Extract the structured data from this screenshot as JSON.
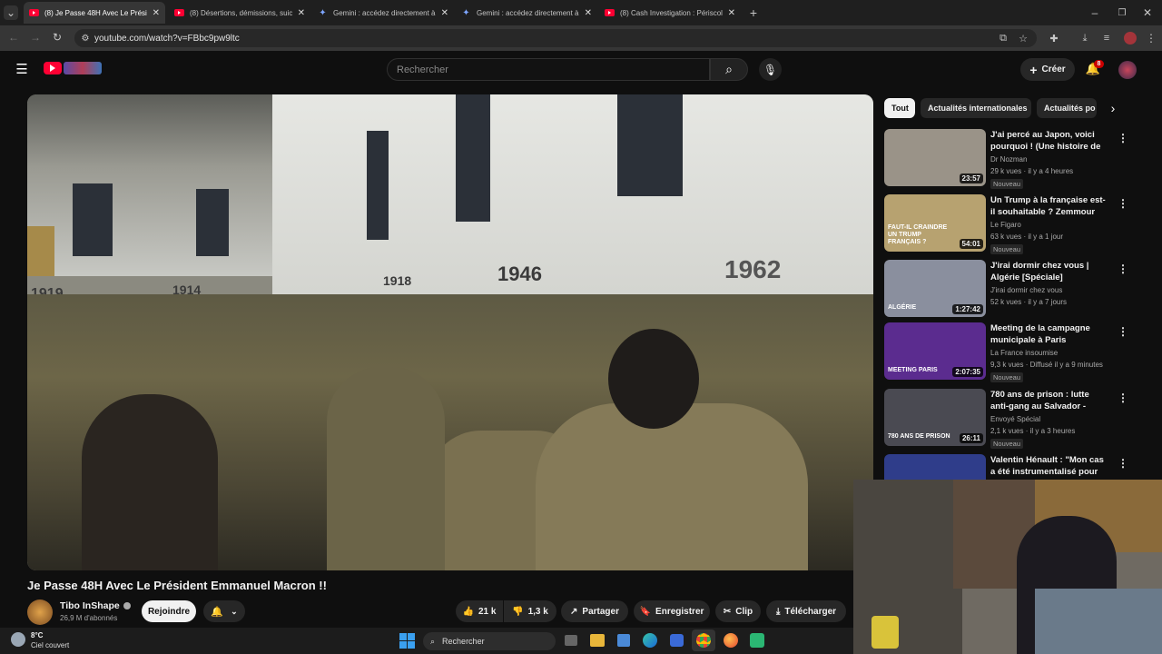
{
  "browser": {
    "tabs": [
      {
        "title": "(8) Je Passe 48H Avec Le Présid",
        "icon": "youtube",
        "active": true
      },
      {
        "title": "(8) Désertions, démissions, suic",
        "icon": "youtube",
        "active": false
      },
      {
        "title": "Gemini : accédez directement à",
        "icon": "gemini",
        "active": false
      },
      {
        "title": "Gemini : accédez directement à",
        "icon": "gemini",
        "active": false
      },
      {
        "title": "(8) Cash Investigation : Périscol",
        "icon": "youtube",
        "active": false
      }
    ],
    "url": "youtube.com/watch?v=FBbc9pw9ltc"
  },
  "header": {
    "search_placeholder": "Rechercher",
    "create_label": "Créer",
    "notif_count": "8"
  },
  "video": {
    "title": "Je Passe 48H Avec Le Président Emmanuel Macron !!",
    "channel": "Tibo InShape",
    "subscribers": "26,9 M d'abonnés",
    "join_label": "Rejoindre",
    "likes": "21 k",
    "dislikes": "1,3 k",
    "share_label": "Partager",
    "save_label": "Enregistrer",
    "clip_label": "Clip",
    "download_label": "Télécharger",
    "wall_texts": [
      "1919",
      "1914",
      "1918",
      "1946",
      "1962"
    ]
  },
  "chips": [
    "Tout",
    "Actualités internationales",
    "Actualités po"
  ],
  "recommendations": [
    {
      "title": "J'ai percé au Japon, voici pourquoi ! (Une histoire de ...",
      "channel": "Dr Nozman",
      "meta": "29 k vues · il y a 4 heures",
      "duration": "23:57",
      "badge": "Nouveau",
      "thumb_color": "#9a9388"
    },
    {
      "title": "Un Trump à la française est-il souhaitable ? Zemmour face à...",
      "channel": "Le Figaro",
      "meta": "63 k vues · il y a 1 jour",
      "duration": "54:01",
      "badge": "Nouveau",
      "thumb_text": "FAUT-IL CRAINDRE UN TRUMP FRANÇAIS ?",
      "thumb_color": "#b7a270"
    },
    {
      "title": "J'irai dormir chez vous | Algérie [Spéciale]",
      "channel": "J'irai dormir chez vous",
      "meta": "52 k vues · il y a 7 jours",
      "duration": "1:27:42",
      "badge": "",
      "thumb_text": "ALGÉRIE",
      "thumb_color": "#8a8f9e"
    },
    {
      "title": "Meeting de la campagne municipale à Paris",
      "channel": "La France insoumise",
      "meta": "9,3 k vues · Diffusé il y a 9 minutes",
      "duration": "2:07:35",
      "badge": "Nouveau",
      "thumb_text": "MEETING PARIS",
      "thumb_color": "#5b2c8f"
    },
    {
      "title": "780 ans de prison : lutte anti-gang au Salvador - reportage ...",
      "channel": "Envoyé Spécial",
      "meta": "2,1 k vues · il y a 3 heures",
      "duration": "26:11",
      "badge": "Nouveau",
      "thumb_text": "780 ANS DE PRISON",
      "thumb_color": "#4a4a52"
    },
    {
      "title": "Valentin Hénault : \"Mon cas a été instrumentalisé pour jeter l...",
      "channel": "",
      "meta": "",
      "duration": "",
      "badge": "",
      "thumb_color": "#2f3d8a"
    }
  ],
  "taskbar": {
    "temp": "8°C",
    "weather": "Ciel couvert",
    "search_label": "Rechercher"
  },
  "colors": {
    "youtube_red": "#ff0033",
    "background": "#0f0f0f"
  }
}
